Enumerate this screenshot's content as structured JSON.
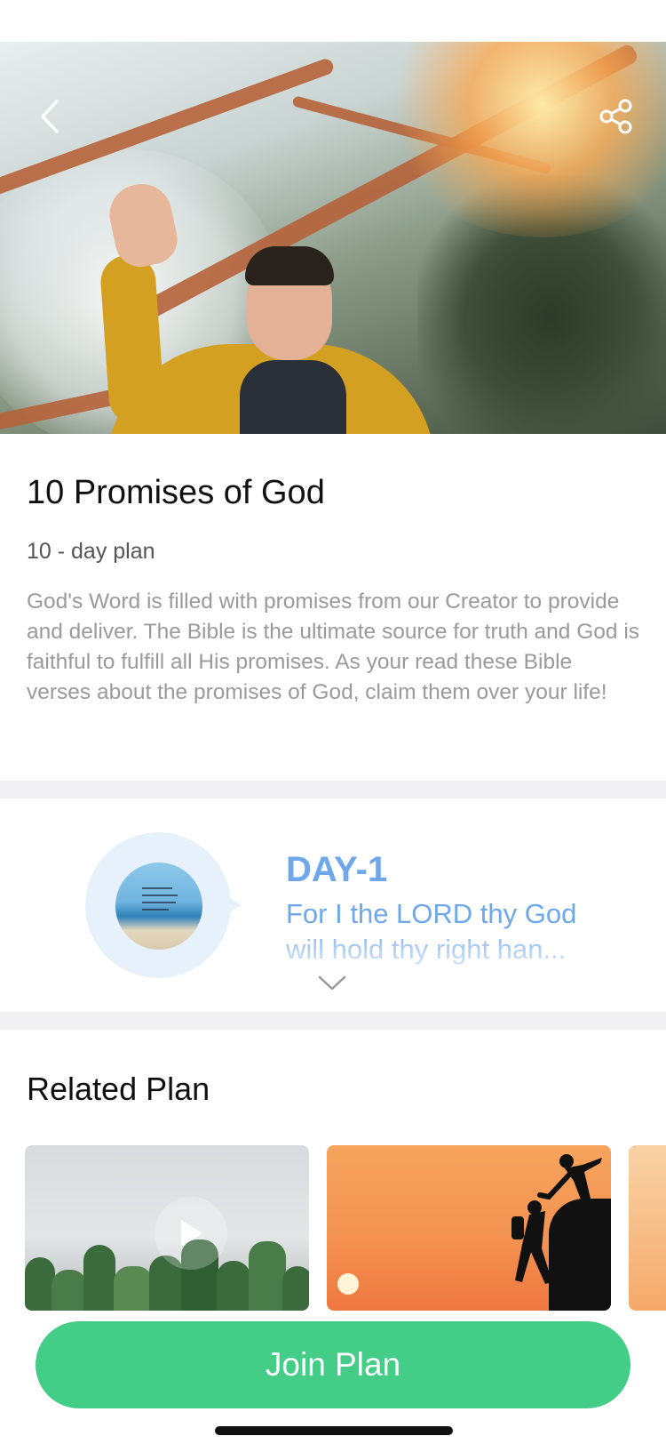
{
  "header": {
    "back_icon": "chevron-left-icon",
    "share_icon": "share-icon"
  },
  "plan": {
    "title": "10 Promises of God",
    "duration": "10 - day plan",
    "description": "God's Word is filled with promises from our Creator to provide and deliver. The Bible is the ultimate source for truth and God is faithful to fulfill all His promises. As your read these Bible verses about the promises of God, claim them over your life!"
  },
  "day_preview": {
    "label": "DAY-1",
    "verse": "For I the LORD thy God will hold thy right han...",
    "expand_icon": "chevron-down-icon",
    "accent_color": "#6ea7ea"
  },
  "related": {
    "title": "Related Plan",
    "items": [
      {
        "image": "cactus-photo",
        "icon": "play-icon"
      },
      {
        "image": "sunset-climbers-photo"
      },
      {
        "image": "warm-photo"
      }
    ]
  },
  "footer": {
    "join_label": "Join Plan",
    "button_color": "#43cd86"
  }
}
